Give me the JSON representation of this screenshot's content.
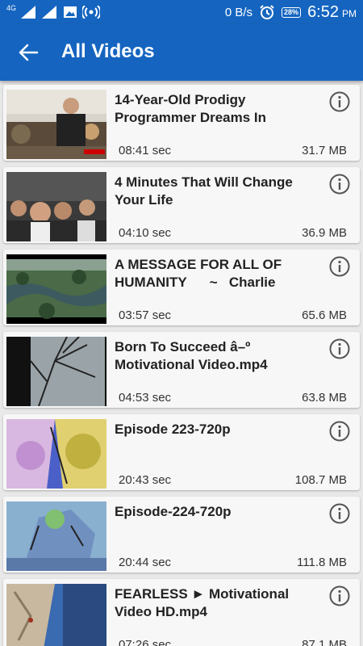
{
  "status_bar": {
    "network_type": "4G",
    "sim1_label": "1",
    "sim2_label": "2",
    "data_speed": "0 B/s",
    "battery": "28%",
    "time": "6:52",
    "ampm": "PM"
  },
  "app_bar": {
    "title": "All Videos",
    "back_icon": "arrow-back-icon"
  },
  "videos": [
    {
      "title": "14-Year-Old Prodigy Programmer Dreams In",
      "duration": "08:41 sec",
      "size": "31.7 MB"
    },
    {
      "title": "4 Minutes That Will Change Your Life",
      "duration": "04:10 sec",
      "size": "36.9 MB"
    },
    {
      "title": "A MESSAGE FOR ALL OF HUMANITY      ~   Charlie",
      "duration": "03:57 sec",
      "size": "65.6 MB"
    },
    {
      "title": "Born To Succeed â–º Motivational Video.mp4",
      "duration": "04:53 sec",
      "size": "63.8 MB"
    },
    {
      "title": "Episode 223-720p",
      "duration": "20:43 sec",
      "size": "108.7 MB"
    },
    {
      "title": "Episode-224-720p",
      "duration": "20:44 sec",
      "size": "111.8 MB"
    },
    {
      "title": "FEARLESS ► Motivational Video HD.mp4",
      "duration": "07:26 sec",
      "size": "87.1 MB"
    }
  ],
  "colors": {
    "primary": "#1565c0",
    "card_bg": "#f7f7f7",
    "list_bg": "#e8e8e8"
  }
}
